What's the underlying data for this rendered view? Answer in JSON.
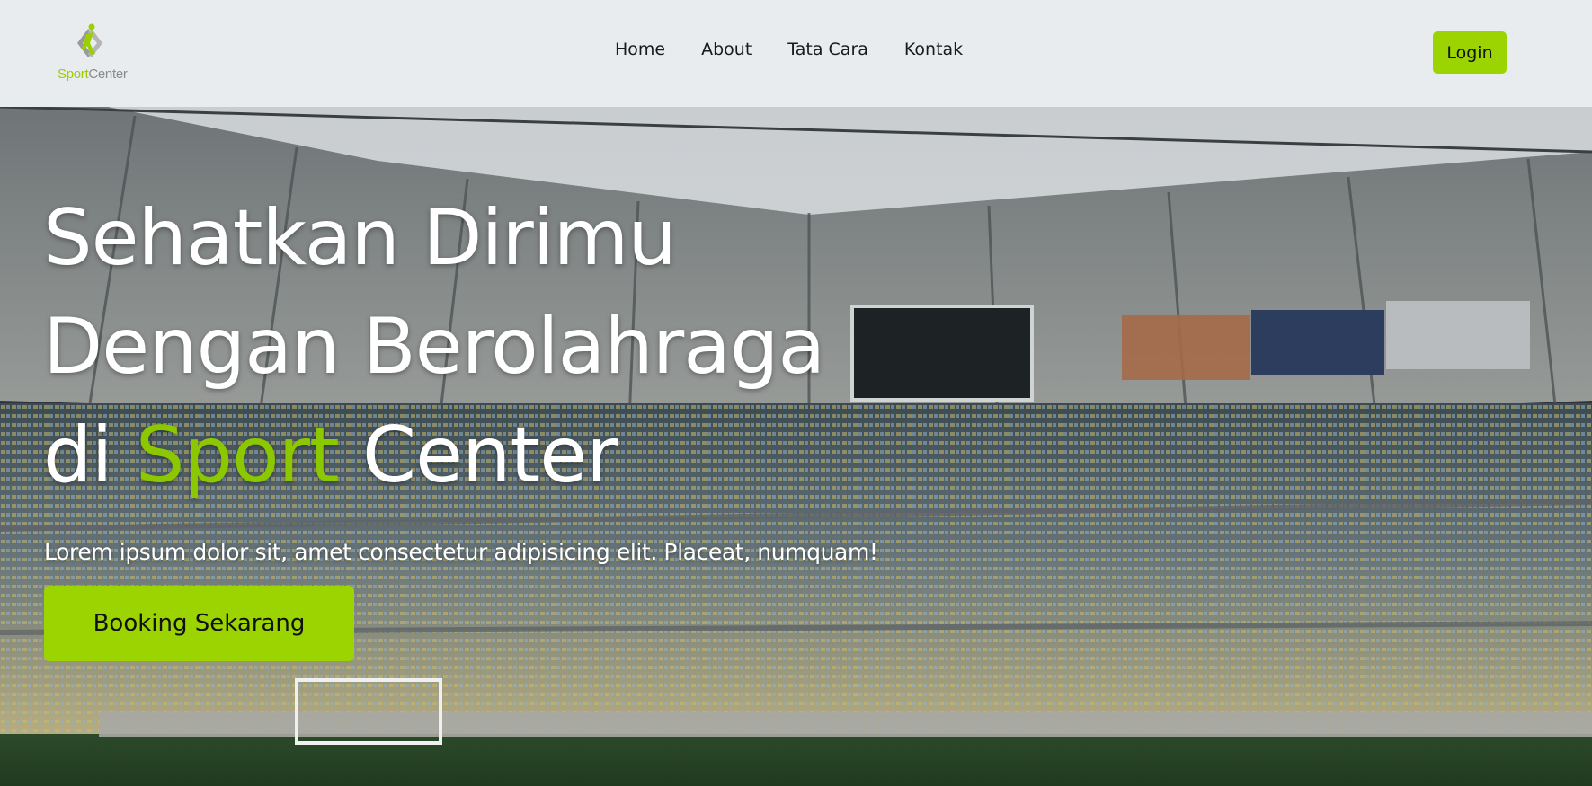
{
  "brand": {
    "logo_accent": "Sport",
    "logo_rest": "Center",
    "colors": {
      "accent": "#9bd400",
      "nav_bg": "#e9ecef"
    }
  },
  "nav": {
    "items": [
      {
        "label": "Home"
      },
      {
        "label": "About"
      },
      {
        "label": "Tata Cara"
      },
      {
        "label": "Kontak"
      }
    ],
    "login_label": "Login"
  },
  "hero": {
    "title_line1": "Sehatkan Dirimu",
    "title_line2": "Dengan Berolahraga",
    "title_line3_prefix": "di ",
    "title_line3_accent": "Sport",
    "title_line3_suffix": " Center",
    "subtitle": "Lorem ipsum dolor sit, amet consectetur adipisicing elit. Placeat, numquam!",
    "cta_label": "Booking Sekarang",
    "background": "stadium-photo"
  }
}
